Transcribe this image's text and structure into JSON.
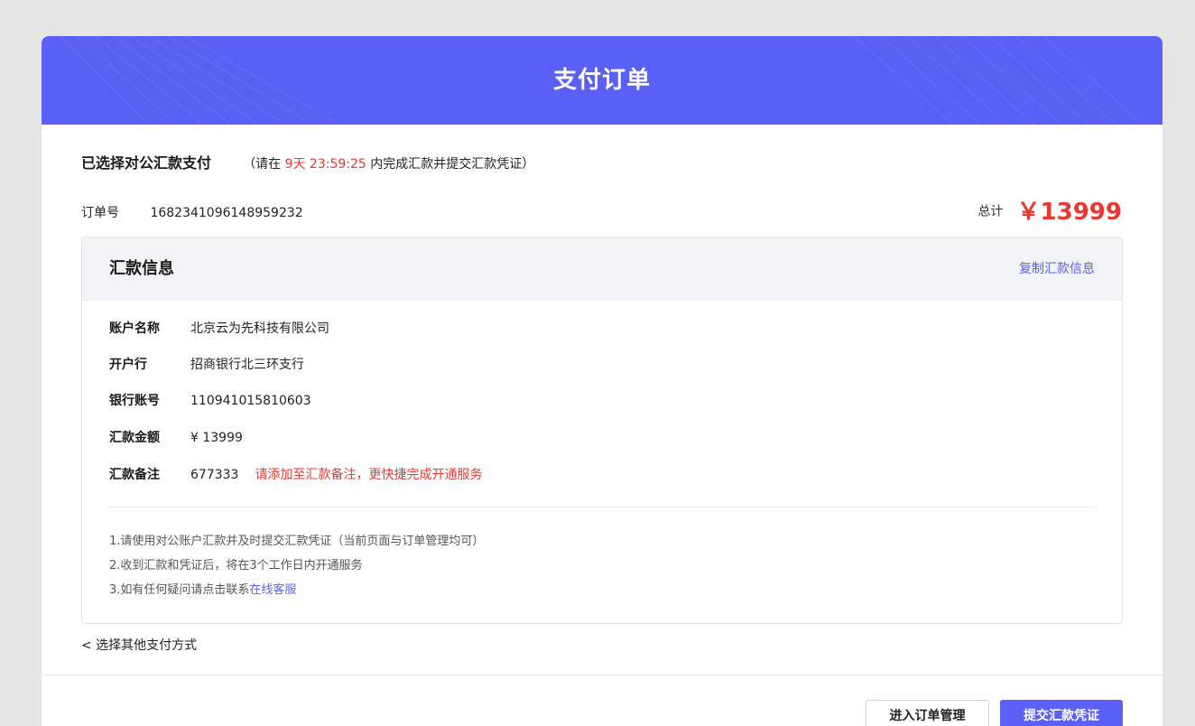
{
  "header": {
    "title": "支付订单"
  },
  "selection": {
    "title": "已选择对公汇款支付",
    "note_prefix": "（请在 ",
    "countdown": "9天 23:59:25",
    "note_suffix": " 内完成汇款并提交汇款凭证）"
  },
  "order": {
    "label": "订单号",
    "number": "1682341096148959232",
    "total_label": "总计",
    "total_amount": "￥13999"
  },
  "remit_info": {
    "title": "汇款信息",
    "copy_label": "复制汇款信息",
    "fields": [
      {
        "label": "账户名称",
        "value": "北京云为先科技有限公司"
      },
      {
        "label": "开户行",
        "value": "招商银行北三环支行"
      },
      {
        "label": "银行账号",
        "value": "110941015810603"
      },
      {
        "label": "汇款金额",
        "value": "¥ 13999"
      },
      {
        "label": "汇款备注",
        "value": "677333",
        "note": "请添加至汇款备注，更快捷完成开通服务"
      }
    ],
    "tips": [
      "1.请使用对公账户汇款并及时提交汇款凭证（当前页面与订单管理均可）",
      "2.收到汇款和凭证后，将在3个工作日内开通服务",
      "3.如有任何疑问请点击联系"
    ],
    "support_link": "在线客服"
  },
  "back_link": "< 选择其他支付方式",
  "buttons": {
    "order_manage": "进入订单管理",
    "submit_voucher": "提交汇款凭证"
  },
  "colors": {
    "accent": "#5a5ff5",
    "alert": "#e8382f",
    "background": "#e5e5e5"
  }
}
